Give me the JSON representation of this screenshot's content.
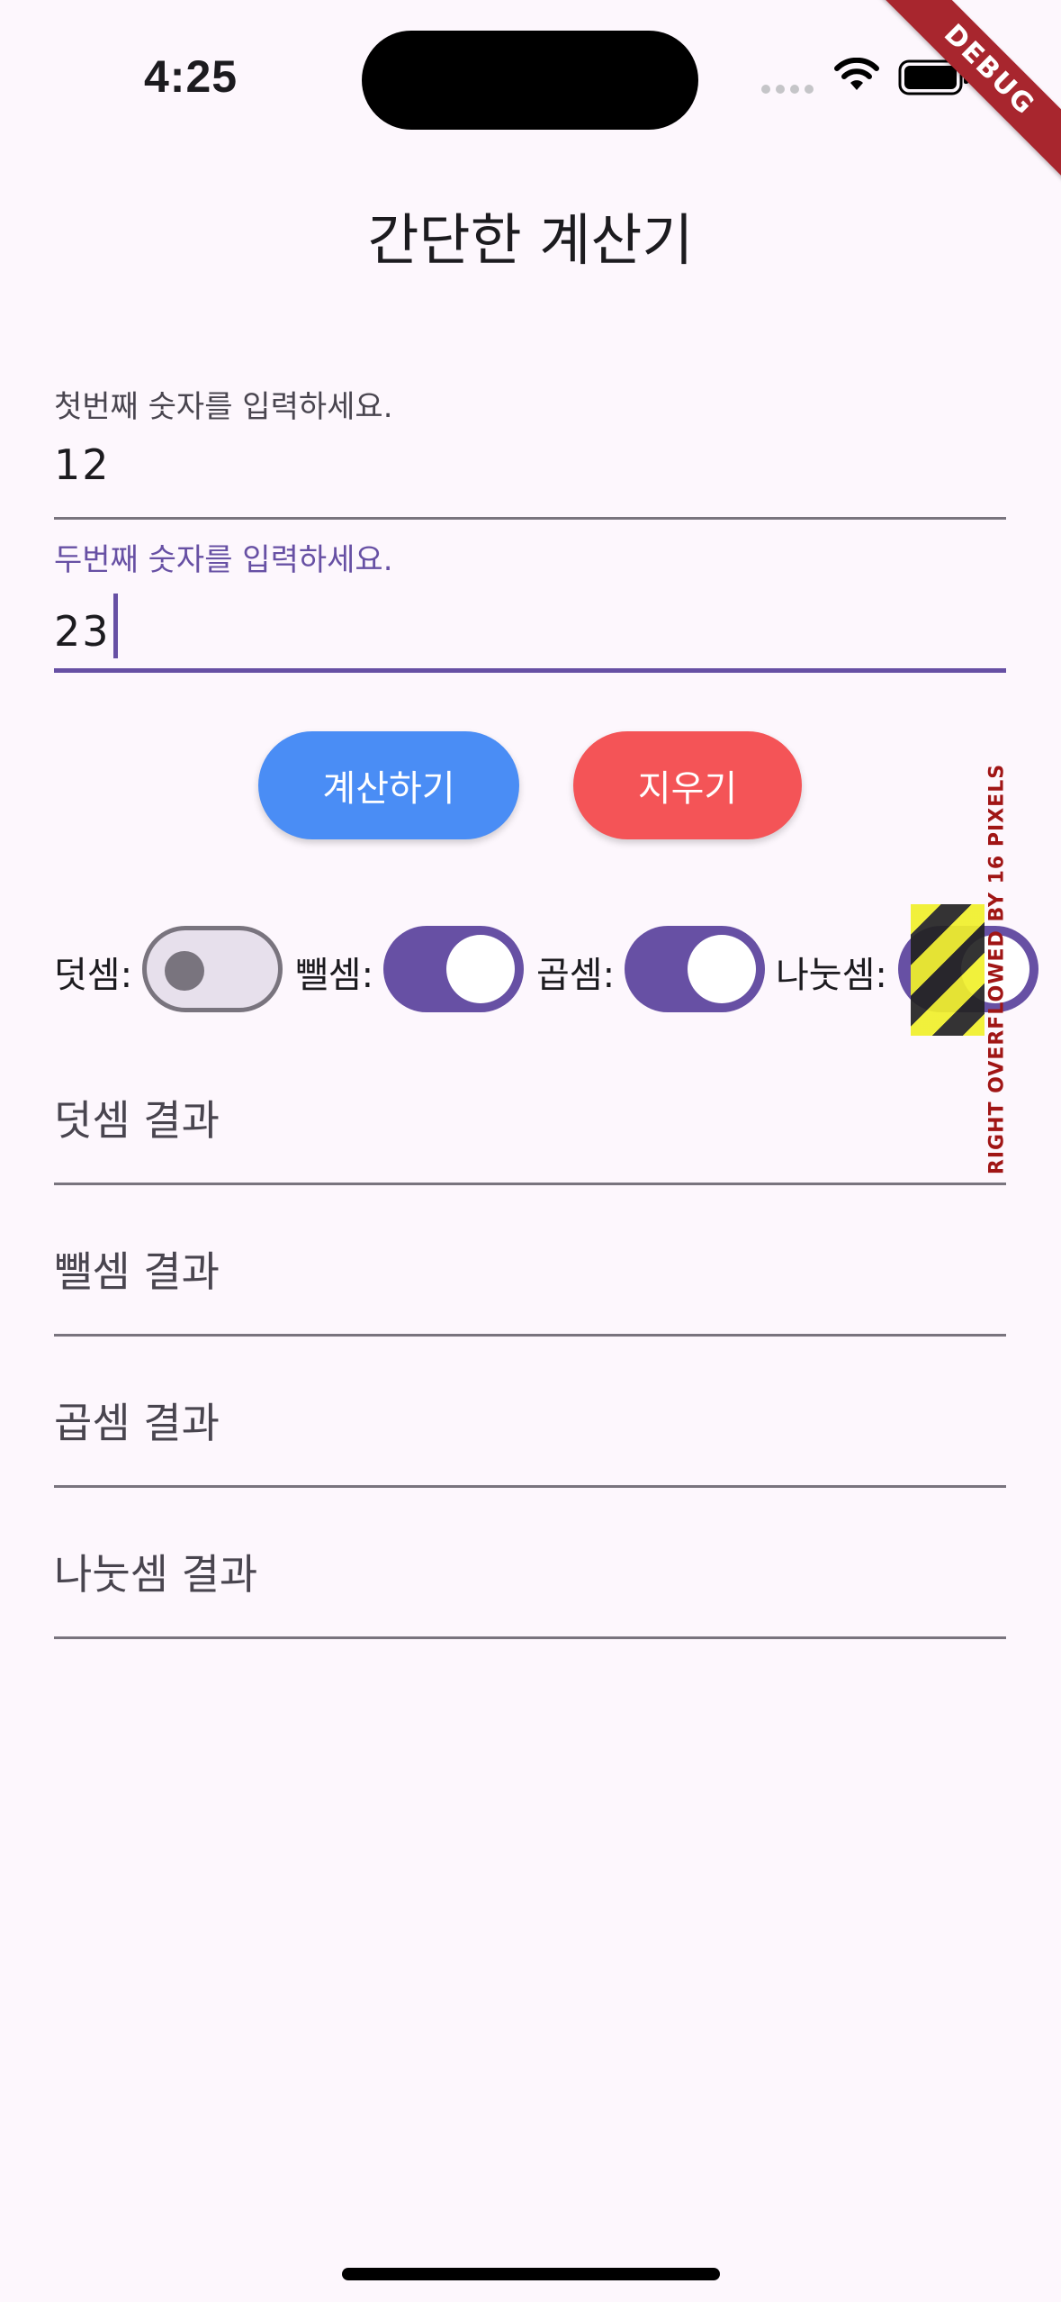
{
  "status_bar": {
    "time": "4:25",
    "debug": "DEBUG"
  },
  "app": {
    "title": "간단한 계산기"
  },
  "inputs": {
    "first": {
      "label": "첫번째 숫자를 입력하세요.",
      "value": "12"
    },
    "second": {
      "label": "두번째 숫자를 입력하세요.",
      "value": "23"
    }
  },
  "buttons": {
    "calculate": "계산하기",
    "clear": "지우기"
  },
  "toggles": [
    {
      "label": "덧셈:",
      "on": false
    },
    {
      "label": "뺄셈:",
      "on": true
    },
    {
      "label": "곱셈:",
      "on": true
    },
    {
      "label": "나눗셈:",
      "on": true
    }
  ],
  "overflow_warning": "RIGHT OVERFLOWED BY 16 PIXELS",
  "results": {
    "add": "덧셈 결과",
    "subtract": "뺄셈 결과",
    "multiply": "곱셈 결과",
    "divide": "나눗셈 결과"
  },
  "colors": {
    "primary": "#6750a4",
    "calculate_button": "#4a8df5",
    "clear_button": "#f45457",
    "background": "#fdf7fd"
  }
}
